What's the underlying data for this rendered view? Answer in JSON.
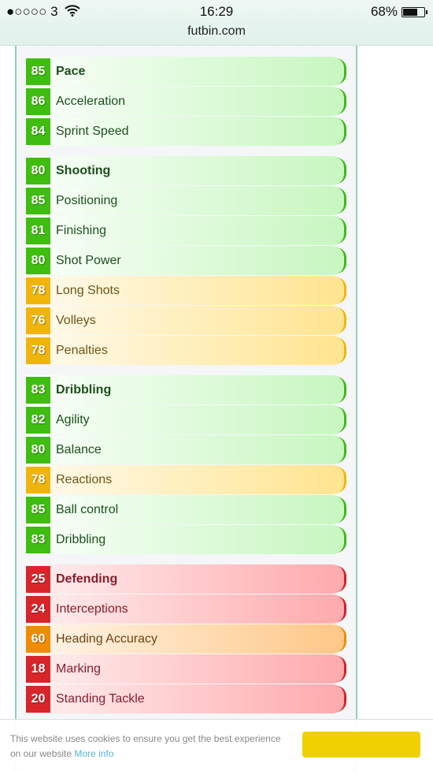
{
  "status_bar": {
    "carrier": "●○○○○ 3",
    "wifi_icon": "wifi-icon",
    "time": "16:29",
    "battery": "68%",
    "battery_level": 0.68
  },
  "browser": {
    "url": "futbin.com"
  },
  "stat_groups": [
    {
      "stats": [
        {
          "value": "85",
          "label": "Pace",
          "header": true,
          "tier": "green"
        },
        {
          "value": "86",
          "label": "Acceleration",
          "tier": "green"
        },
        {
          "value": "84",
          "label": "Sprint Speed",
          "tier": "green"
        }
      ]
    },
    {
      "stats": [
        {
          "value": "80",
          "label": "Shooting",
          "header": true,
          "tier": "green"
        },
        {
          "value": "85",
          "label": "Positioning",
          "tier": "green"
        },
        {
          "value": "81",
          "label": "Finishing",
          "tier": "green"
        },
        {
          "value": "80",
          "label": "Shot Power",
          "tier": "green"
        },
        {
          "value": "78",
          "label": "Long Shots",
          "tier": "yellow"
        },
        {
          "value": "76",
          "label": "Volleys",
          "tier": "yellow"
        },
        {
          "value": "78",
          "label": "Penalties",
          "tier": "yellow"
        }
      ]
    },
    {
      "stats": [
        {
          "value": "83",
          "label": "Dribbling",
          "header": true,
          "tier": "green"
        },
        {
          "value": "82",
          "label": "Agility",
          "tier": "green"
        },
        {
          "value": "80",
          "label": "Balance",
          "tier": "green"
        },
        {
          "value": "78",
          "label": "Reactions",
          "tier": "yellow"
        },
        {
          "value": "85",
          "label": "Ball control",
          "tier": "green"
        },
        {
          "value": "83",
          "label": "Dribbling",
          "tier": "green"
        }
      ]
    },
    {
      "stats": [
        {
          "value": "25",
          "label": "Defending",
          "header": true,
          "tier": "red"
        },
        {
          "value": "24",
          "label": "Interceptions",
          "tier": "red"
        },
        {
          "value": "60",
          "label": "Heading Accuracy",
          "tier": "orange"
        },
        {
          "value": "18",
          "label": "Marking",
          "tier": "red"
        },
        {
          "value": "20",
          "label": "Standing Tackle",
          "tier": "red"
        }
      ]
    }
  ],
  "tier_colors": {
    "green": "#3fbd10",
    "yellow": "#efb50a",
    "orange": "#f08c00",
    "red": "#d8252a"
  },
  "cookie_banner": {
    "text": "This website uses cookies to ensure you get the best experience on our website",
    "link": "More info",
    "button_color": "#f1d000"
  }
}
